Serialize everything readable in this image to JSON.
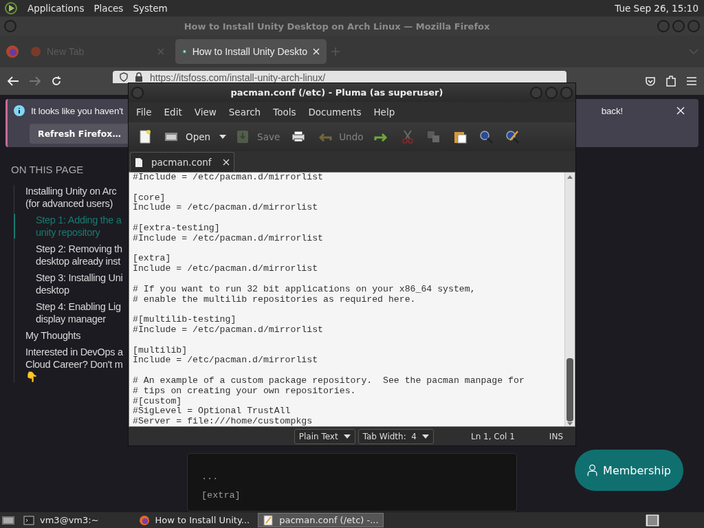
{
  "panel": {
    "menus": [
      "Applications",
      "Places",
      "System"
    ],
    "clock": "Tue Sep 26, 15:10"
  },
  "firefox": {
    "title": "How to Install Unity Desktop on Arch Linux — Mozilla Firefox",
    "tabs": [
      {
        "label": "New Tab",
        "selected": false
      },
      {
        "label": "How to Install Unity Deskto",
        "selected": true
      }
    ],
    "url": "https://itsfoss.com/install-unity-arch-linux/",
    "notification": {
      "message_start": "It looks like you haven't",
      "message_end": "back!",
      "button": "Refresh Firefox…"
    },
    "toc": {
      "heading": "ON THIS PAGE",
      "items": [
        {
          "text": "Installing Unity on Arc\n(for advanced users)",
          "selected": false,
          "children": [
            {
              "text": "Step 1: Adding the a\nunity repository",
              "selected": true
            },
            {
              "text": "Step 2: Removing th\ndesktop already inst",
              "selected": false
            },
            {
              "text": "Step 3: Installing Uni\ndesktop",
              "selected": false
            },
            {
              "text": "Step 4: Enabling Lig\ndisplay manager",
              "selected": false
            }
          ]
        },
        {
          "text": "My Thoughts",
          "selected": false
        },
        {
          "text": "Interested in DevOps a\nCloud Career? Don't m\n👇",
          "selected": false
        }
      ]
    },
    "code_block": "...\n[extra]",
    "membership": "Membership"
  },
  "pluma": {
    "title": "pacman.conf (/etc) - Pluma (as superuser)",
    "menus": [
      "File",
      "Edit",
      "View",
      "Search",
      "Tools",
      "Documents",
      "Help"
    ],
    "toolbar": [
      {
        "kind": "new",
        "disabled": false
      },
      {
        "kind": "open",
        "label": "Open",
        "disabled": false
      },
      {
        "kind": "save",
        "label": "Save",
        "disabled": true
      },
      {
        "kind": "print",
        "disabled": false
      },
      {
        "kind": "undo",
        "label": "Undo",
        "disabled": true
      },
      {
        "kind": "redo",
        "disabled": false
      },
      {
        "kind": "cut",
        "disabled": true
      },
      {
        "kind": "copy",
        "disabled": true
      },
      {
        "kind": "paste",
        "disabled": false
      },
      {
        "kind": "find",
        "disabled": false
      },
      {
        "kind": "replace",
        "disabled": false
      }
    ],
    "tab": "pacman.conf",
    "text": "#Include = /etc/pacman.d/mirrorlist\n\n[core]\nInclude = /etc/pacman.d/mirrorlist\n\n#[extra-testing]\n#Include = /etc/pacman.d/mirrorlist\n\n[extra]\nInclude = /etc/pacman.d/mirrorlist\n\n# If you want to run 32 bit applications on your x86_64 system,\n# enable the multilib repositories as required here.\n\n#[multilib-testing]\n#Include = /etc/pacman.d/mirrorlist\n\n[multilib]\nInclude = /etc/pacman.d/mirrorlist\n\n# An example of a custom package repository.  See the pacman manpage for\n# tips on creating your own repositories.\n#[custom]\n#SigLevel = Optional TrustAll\n#Server = file:///home/custompkgs",
    "status": {
      "language": "Plain Text",
      "tab_width": "Tab Width:  4",
      "position": "Ln 1, Col 1",
      "mode": "INS"
    }
  },
  "taskbar": [
    {
      "kind": "terminal",
      "label": "vm3@vm3:~",
      "selected": false
    },
    {
      "kind": "browser",
      "label": "How to Install Unity...",
      "selected": false
    },
    {
      "kind": "editor",
      "label": "pacman.conf (/etc) -...",
      "selected": true
    }
  ]
}
